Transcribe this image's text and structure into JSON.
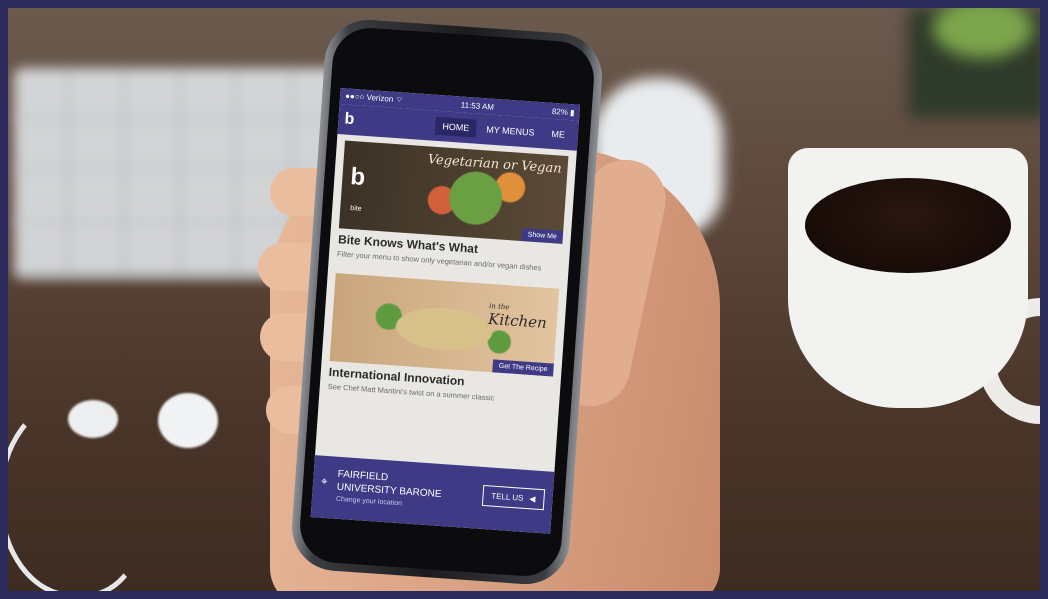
{
  "app": {
    "status": {
      "carrier": "Verizon",
      "time": "11:53 AM",
      "battery": "82%"
    },
    "nav": {
      "logo": "b",
      "tabs": [
        {
          "label": "HOME"
        },
        {
          "label": "MY MENUS"
        },
        {
          "label": "ME"
        }
      ]
    },
    "cards": [
      {
        "image_title": "Vegetarian or Vegan",
        "image_brand": "b",
        "image_brand_small": "bite",
        "button": "Show Me",
        "title": "Bite Knows What's What",
        "desc": "Filter your menu to show only vegetarian and/or vegan dishes"
      },
      {
        "image_title_small": "in the",
        "image_title": "Kitchen",
        "button": "Get The Recipe",
        "title": "International Innovation",
        "desc": "See Chef Matt Mantini's twist on a summer classic"
      }
    ],
    "footer": {
      "location_line1": "FAIRFIELD",
      "location_line2": "UNIVERSITY BARONE",
      "change_location": "Change your location",
      "tell_us": "TELL US"
    }
  },
  "colors": {
    "brand_purple": "#3f3a86",
    "background_frame": "#2d2a5c"
  },
  "icons": {
    "location": "map-pin-icon",
    "megaphone": "megaphone-icon",
    "wifi": "wifi-icon"
  }
}
